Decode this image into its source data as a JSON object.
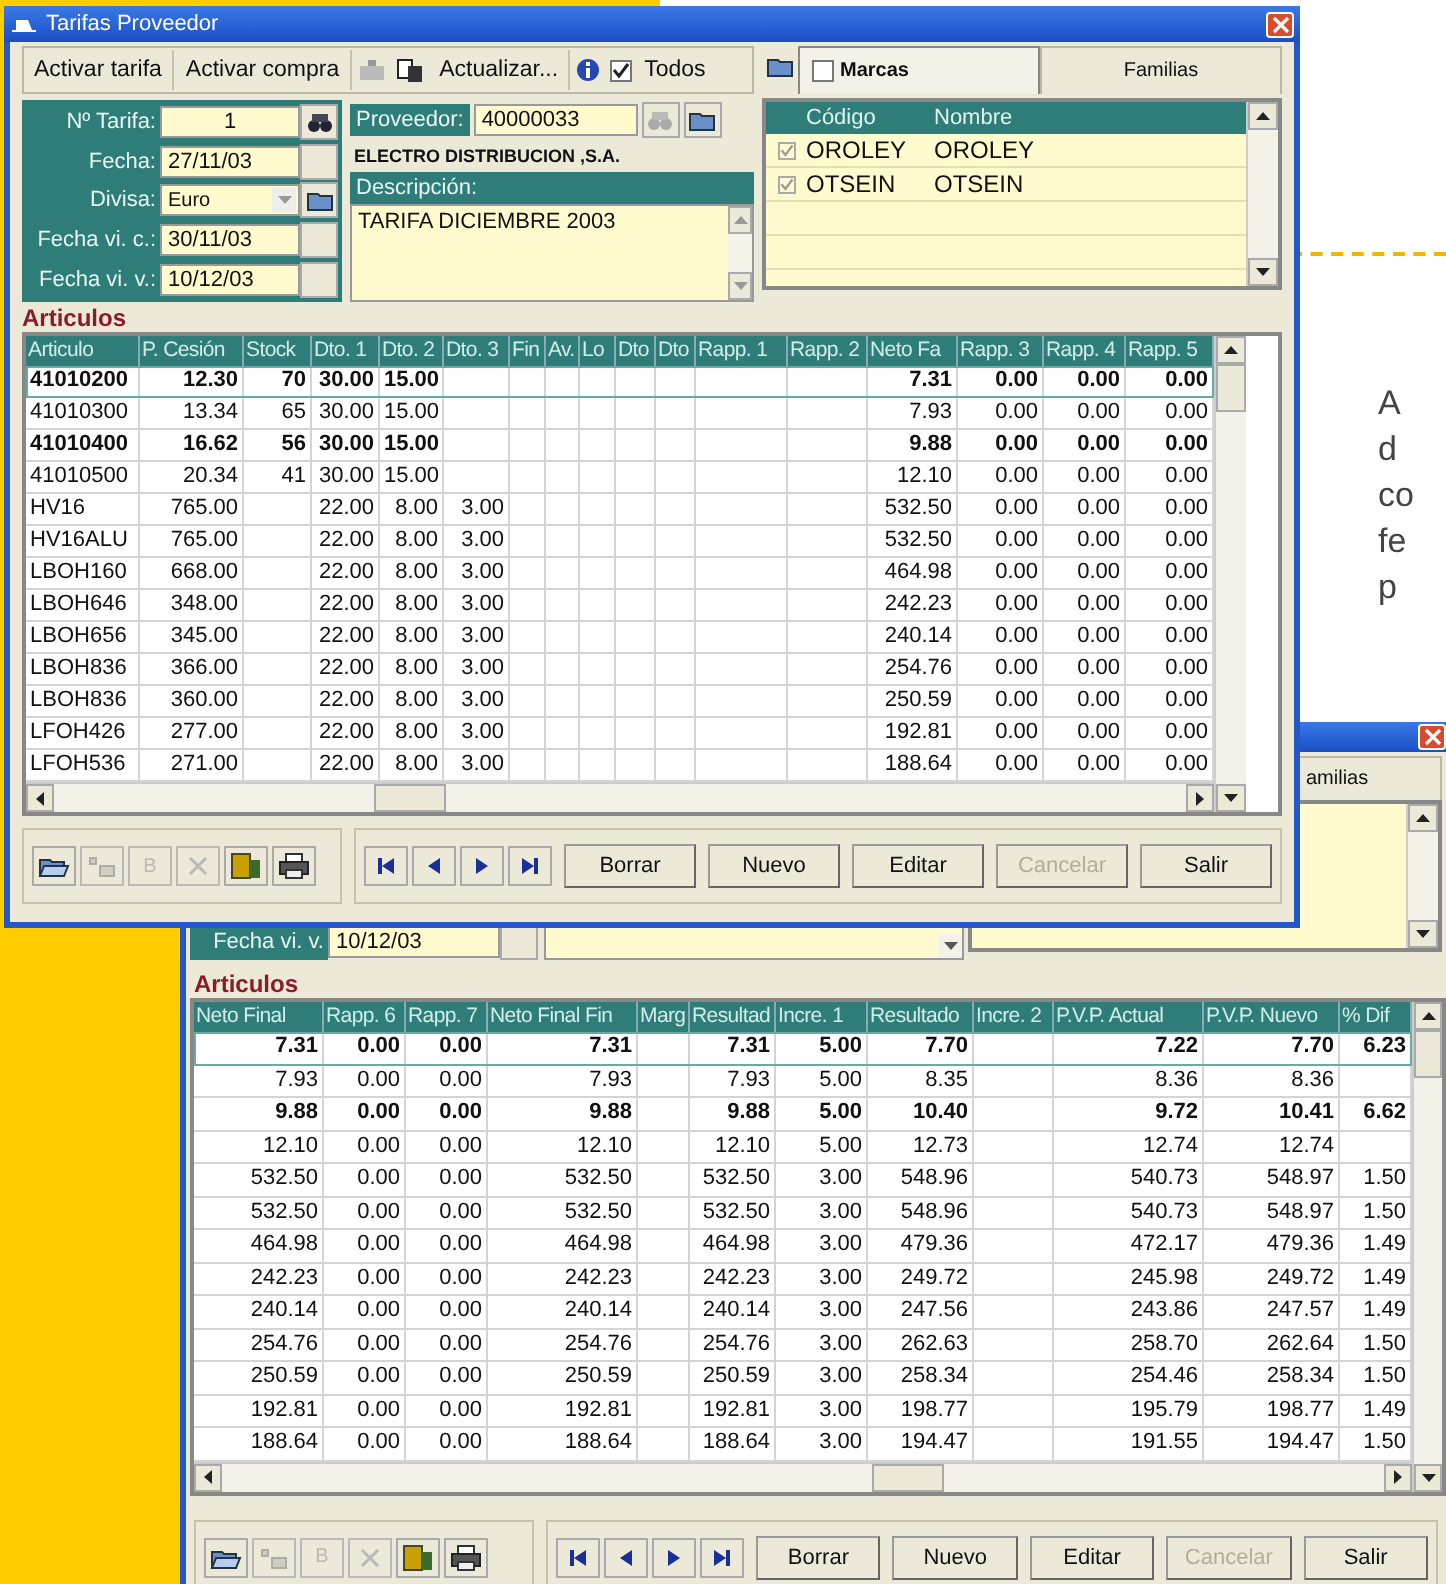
{
  "window1": {
    "title": "Tarifas Proveedor",
    "toolbar": [
      {
        "label": "Activar tarifa"
      },
      {
        "label": "Activar compra"
      },
      {
        "label": "Actualizar..."
      }
    ],
    "todos": {
      "label": "Todos",
      "checked": true
    },
    "tabs": [
      {
        "kind": "checkbox",
        "label": "Marcas",
        "checked": false,
        "selected": true
      },
      {
        "kind": "plain",
        "label": "Familias",
        "selected": false
      }
    ],
    "fields": [
      {
        "kind": "lookup",
        "label": "Nº Tarifa:",
        "value": "1"
      },
      {
        "kind": "date",
        "label": "Fecha:",
        "value": "27/11/03"
      },
      {
        "kind": "select",
        "label": "Divisa:",
        "value": "Euro"
      },
      {
        "kind": "date",
        "label": "Fecha vi. c.:",
        "value": "30/11/03"
      },
      {
        "kind": "date",
        "label": "Fecha vi. v.:",
        "value": "10/12/03"
      }
    ],
    "supplier": {
      "label": "Proveedor:",
      "value": "40000033",
      "name": "ELECTRO DISTRIBUCION ,S.A."
    },
    "description": {
      "label": "Descripción:",
      "value": "TARIFA DICIEMBRE 2003"
    },
    "brands": {
      "columns": [
        "Código",
        "Nombre"
      ],
      "rows": [
        {
          "checked": true,
          "cells": [
            "OROLEY",
            "OROLEY"
          ]
        },
        {
          "checked": true,
          "cells": [
            "OTSEIN",
            "OTSEIN"
          ]
        }
      ]
    },
    "section": "Articulos",
    "table": {
      "columns": [
        "Articulo",
        "P. Cesión",
        "Stock",
        "Dto. 1",
        "Dto. 2",
        "Dto. 3",
        "Fin",
        "Av.",
        "Lo",
        "Dto",
        "Dto",
        "Rapp. 1",
        "Rapp. 2",
        "Neto Fa",
        "Rapp. 3",
        "Rapp. 4",
        "Rapp. 5"
      ],
      "rows": [
        {
          "bold": true,
          "selected": true,
          "cells": [
            "41010200",
            "12.30",
            "70",
            "30.00",
            "15.00",
            null,
            null,
            null,
            null,
            null,
            null,
            null,
            null,
            "7.31",
            "0.00",
            "0.00",
            "0.00"
          ]
        },
        {
          "bold": false,
          "selected": false,
          "cells": [
            "41010300",
            "13.34",
            "65",
            "30.00",
            "15.00",
            null,
            null,
            null,
            null,
            null,
            null,
            null,
            null,
            "7.93",
            "0.00",
            "0.00",
            "0.00"
          ]
        },
        {
          "bold": true,
          "selected": false,
          "cells": [
            "41010400",
            "16.62",
            "56",
            "30.00",
            "15.00",
            null,
            null,
            null,
            null,
            null,
            null,
            null,
            null,
            "9.88",
            "0.00",
            "0.00",
            "0.00"
          ]
        },
        {
          "bold": false,
          "selected": false,
          "cells": [
            "41010500",
            "20.34",
            "41",
            "30.00",
            "15.00",
            null,
            null,
            null,
            null,
            null,
            null,
            null,
            null,
            "12.10",
            "0.00",
            "0.00",
            "0.00"
          ]
        },
        {
          "bold": false,
          "selected": false,
          "cells": [
            "HV16",
            "765.00",
            null,
            "22.00",
            "8.00",
            "3.00",
            null,
            null,
            null,
            null,
            null,
            null,
            null,
            "532.50",
            "0.00",
            "0.00",
            "0.00"
          ]
        },
        {
          "bold": false,
          "selected": false,
          "cells": [
            "HV16ALU",
            "765.00",
            null,
            "22.00",
            "8.00",
            "3.00",
            null,
            null,
            null,
            null,
            null,
            null,
            null,
            "532.50",
            "0.00",
            "0.00",
            "0.00"
          ]
        },
        {
          "bold": false,
          "selected": false,
          "cells": [
            "LBOH160",
            "668.00",
            null,
            "22.00",
            "8.00",
            "3.00",
            null,
            null,
            null,
            null,
            null,
            null,
            null,
            "464.98",
            "0.00",
            "0.00",
            "0.00"
          ]
        },
        {
          "bold": false,
          "selected": false,
          "cells": [
            "LBOH646",
            "348.00",
            null,
            "22.00",
            "8.00",
            "3.00",
            null,
            null,
            null,
            null,
            null,
            null,
            null,
            "242.23",
            "0.00",
            "0.00",
            "0.00"
          ]
        },
        {
          "bold": false,
          "selected": false,
          "cells": [
            "LBOH656",
            "345.00",
            null,
            "22.00",
            "8.00",
            "3.00",
            null,
            null,
            null,
            null,
            null,
            null,
            null,
            "240.14",
            "0.00",
            "0.00",
            "0.00"
          ]
        },
        {
          "bold": false,
          "selected": false,
          "cells": [
            "LBOH836",
            "366.00",
            null,
            "22.00",
            "8.00",
            "3.00",
            null,
            null,
            null,
            null,
            null,
            null,
            null,
            "254.76",
            "0.00",
            "0.00",
            "0.00"
          ]
        },
        {
          "bold": false,
          "selected": false,
          "cells": [
            "LBOH836",
            "360.00",
            null,
            "22.00",
            "8.00",
            "3.00",
            null,
            null,
            null,
            null,
            null,
            null,
            null,
            "250.59",
            "0.00",
            "0.00",
            "0.00"
          ]
        },
        {
          "bold": false,
          "selected": false,
          "cells": [
            "LFOH426",
            "277.00",
            null,
            "22.00",
            "8.00",
            "3.00",
            null,
            null,
            null,
            null,
            null,
            null,
            null,
            "192.81",
            "0.00",
            "0.00",
            "0.00"
          ]
        },
        {
          "bold": false,
          "selected": false,
          "cells": [
            "LFOH536",
            "271.00",
            null,
            "22.00",
            "8.00",
            "3.00",
            null,
            null,
            null,
            null,
            null,
            null,
            null,
            "188.64",
            "0.00",
            "0.00",
            "0.00"
          ]
        }
      ]
    },
    "tools": [
      {
        "kind": "folder",
        "disabled": false
      },
      {
        "kind": "add",
        "disabled": true
      },
      {
        "kind": "letter",
        "label": "B",
        "disabled": true
      },
      {
        "kind": "delete",
        "disabled": true
      },
      {
        "kind": "export",
        "disabled": false
      },
      {
        "kind": "print",
        "disabled": false
      }
    ],
    "actions": [
      {
        "label": "Borrar",
        "disabled": false
      },
      {
        "label": "Nuevo",
        "disabled": false
      },
      {
        "label": "Editar",
        "disabled": false
      },
      {
        "label": "Cancelar",
        "disabled": true
      },
      {
        "label": "Salir",
        "disabled": false
      }
    ]
  },
  "window2": {
    "tab_fragment": "amilias",
    "field": {
      "label": "Fecha vi. v.",
      "value": "10/12/03"
    },
    "section": "Articulos",
    "table": {
      "columns": [
        "Neto Final",
        "Rapp. 6",
        "Rapp. 7",
        "Neto Final Fin",
        "Marg",
        "Resultad",
        "Incre. 1",
        "Resultado",
        "Incre. 2",
        "P.V.P. Actual",
        "P.V.P. Nuevo",
        "% Dif"
      ],
      "rows": [
        {
          "bold": true,
          "selected": true,
          "cells": [
            "7.31",
            "0.00",
            "0.00",
            "7.31",
            null,
            "7.31",
            "5.00",
            "7.70",
            null,
            "7.22",
            "7.70",
            "6.23"
          ]
        },
        {
          "bold": false,
          "selected": false,
          "cells": [
            "7.93",
            "0.00",
            "0.00",
            "7.93",
            null,
            "7.93",
            "5.00",
            "8.35",
            null,
            "8.36",
            "8.36",
            null
          ]
        },
        {
          "bold": true,
          "selected": false,
          "cells": [
            "9.88",
            "0.00",
            "0.00",
            "9.88",
            null,
            "9.88",
            "5.00",
            "10.40",
            null,
            "9.72",
            "10.41",
            "6.62"
          ]
        },
        {
          "bold": false,
          "selected": false,
          "cells": [
            "12.10",
            "0.00",
            "0.00",
            "12.10",
            null,
            "12.10",
            "5.00",
            "12.73",
            null,
            "12.74",
            "12.74",
            null
          ]
        },
        {
          "bold": false,
          "selected": false,
          "cells": [
            "532.50",
            "0.00",
            "0.00",
            "532.50",
            null,
            "532.50",
            "3.00",
            "548.96",
            null,
            "540.73",
            "548.97",
            "1.50"
          ]
        },
        {
          "bold": false,
          "selected": false,
          "cells": [
            "532.50",
            "0.00",
            "0.00",
            "532.50",
            null,
            "532.50",
            "3.00",
            "548.96",
            null,
            "540.73",
            "548.97",
            "1.50"
          ]
        },
        {
          "bold": false,
          "selected": false,
          "cells": [
            "464.98",
            "0.00",
            "0.00",
            "464.98",
            null,
            "464.98",
            "3.00",
            "479.36",
            null,
            "472.17",
            "479.36",
            "1.49"
          ]
        },
        {
          "bold": false,
          "selected": false,
          "cells": [
            "242.23",
            "0.00",
            "0.00",
            "242.23",
            null,
            "242.23",
            "3.00",
            "249.72",
            null,
            "245.98",
            "249.72",
            "1.49"
          ]
        },
        {
          "bold": false,
          "selected": false,
          "cells": [
            "240.14",
            "0.00",
            "0.00",
            "240.14",
            null,
            "240.14",
            "3.00",
            "247.56",
            null,
            "243.86",
            "247.57",
            "1.49"
          ]
        },
        {
          "bold": false,
          "selected": false,
          "cells": [
            "254.76",
            "0.00",
            "0.00",
            "254.76",
            null,
            "254.76",
            "3.00",
            "262.63",
            null,
            "258.70",
            "262.64",
            "1.50"
          ]
        },
        {
          "bold": false,
          "selected": false,
          "cells": [
            "250.59",
            "0.00",
            "0.00",
            "250.59",
            null,
            "250.59",
            "3.00",
            "258.34",
            null,
            "254.46",
            "258.34",
            "1.50"
          ]
        },
        {
          "bold": false,
          "selected": false,
          "cells": [
            "192.81",
            "0.00",
            "0.00",
            "192.81",
            null,
            "192.81",
            "3.00",
            "198.77",
            null,
            "195.79",
            "198.77",
            "1.49"
          ]
        },
        {
          "bold": false,
          "selected": false,
          "cells": [
            "188.64",
            "0.00",
            "0.00",
            "188.64",
            null,
            "188.64",
            "3.00",
            "194.47",
            null,
            "191.55",
            "194.47",
            "1.50"
          ]
        }
      ]
    },
    "tools": [
      {
        "kind": "folder",
        "disabled": false
      },
      {
        "kind": "add",
        "disabled": true
      },
      {
        "kind": "letter",
        "label": "B",
        "disabled": true
      },
      {
        "kind": "delete",
        "disabled": true
      },
      {
        "kind": "export",
        "disabled": false
      },
      {
        "kind": "print",
        "disabled": false
      }
    ],
    "actions": [
      {
        "label": "Borrar",
        "disabled": false
      },
      {
        "label": "Nuevo",
        "disabled": false
      },
      {
        "label": "Editar",
        "disabled": false
      },
      {
        "label": "Cancelar",
        "disabled": true
      },
      {
        "label": "Salir",
        "disabled": false
      }
    ]
  },
  "side_text": [
    "A",
    "d",
    "co",
    "fe",
    "p"
  ]
}
